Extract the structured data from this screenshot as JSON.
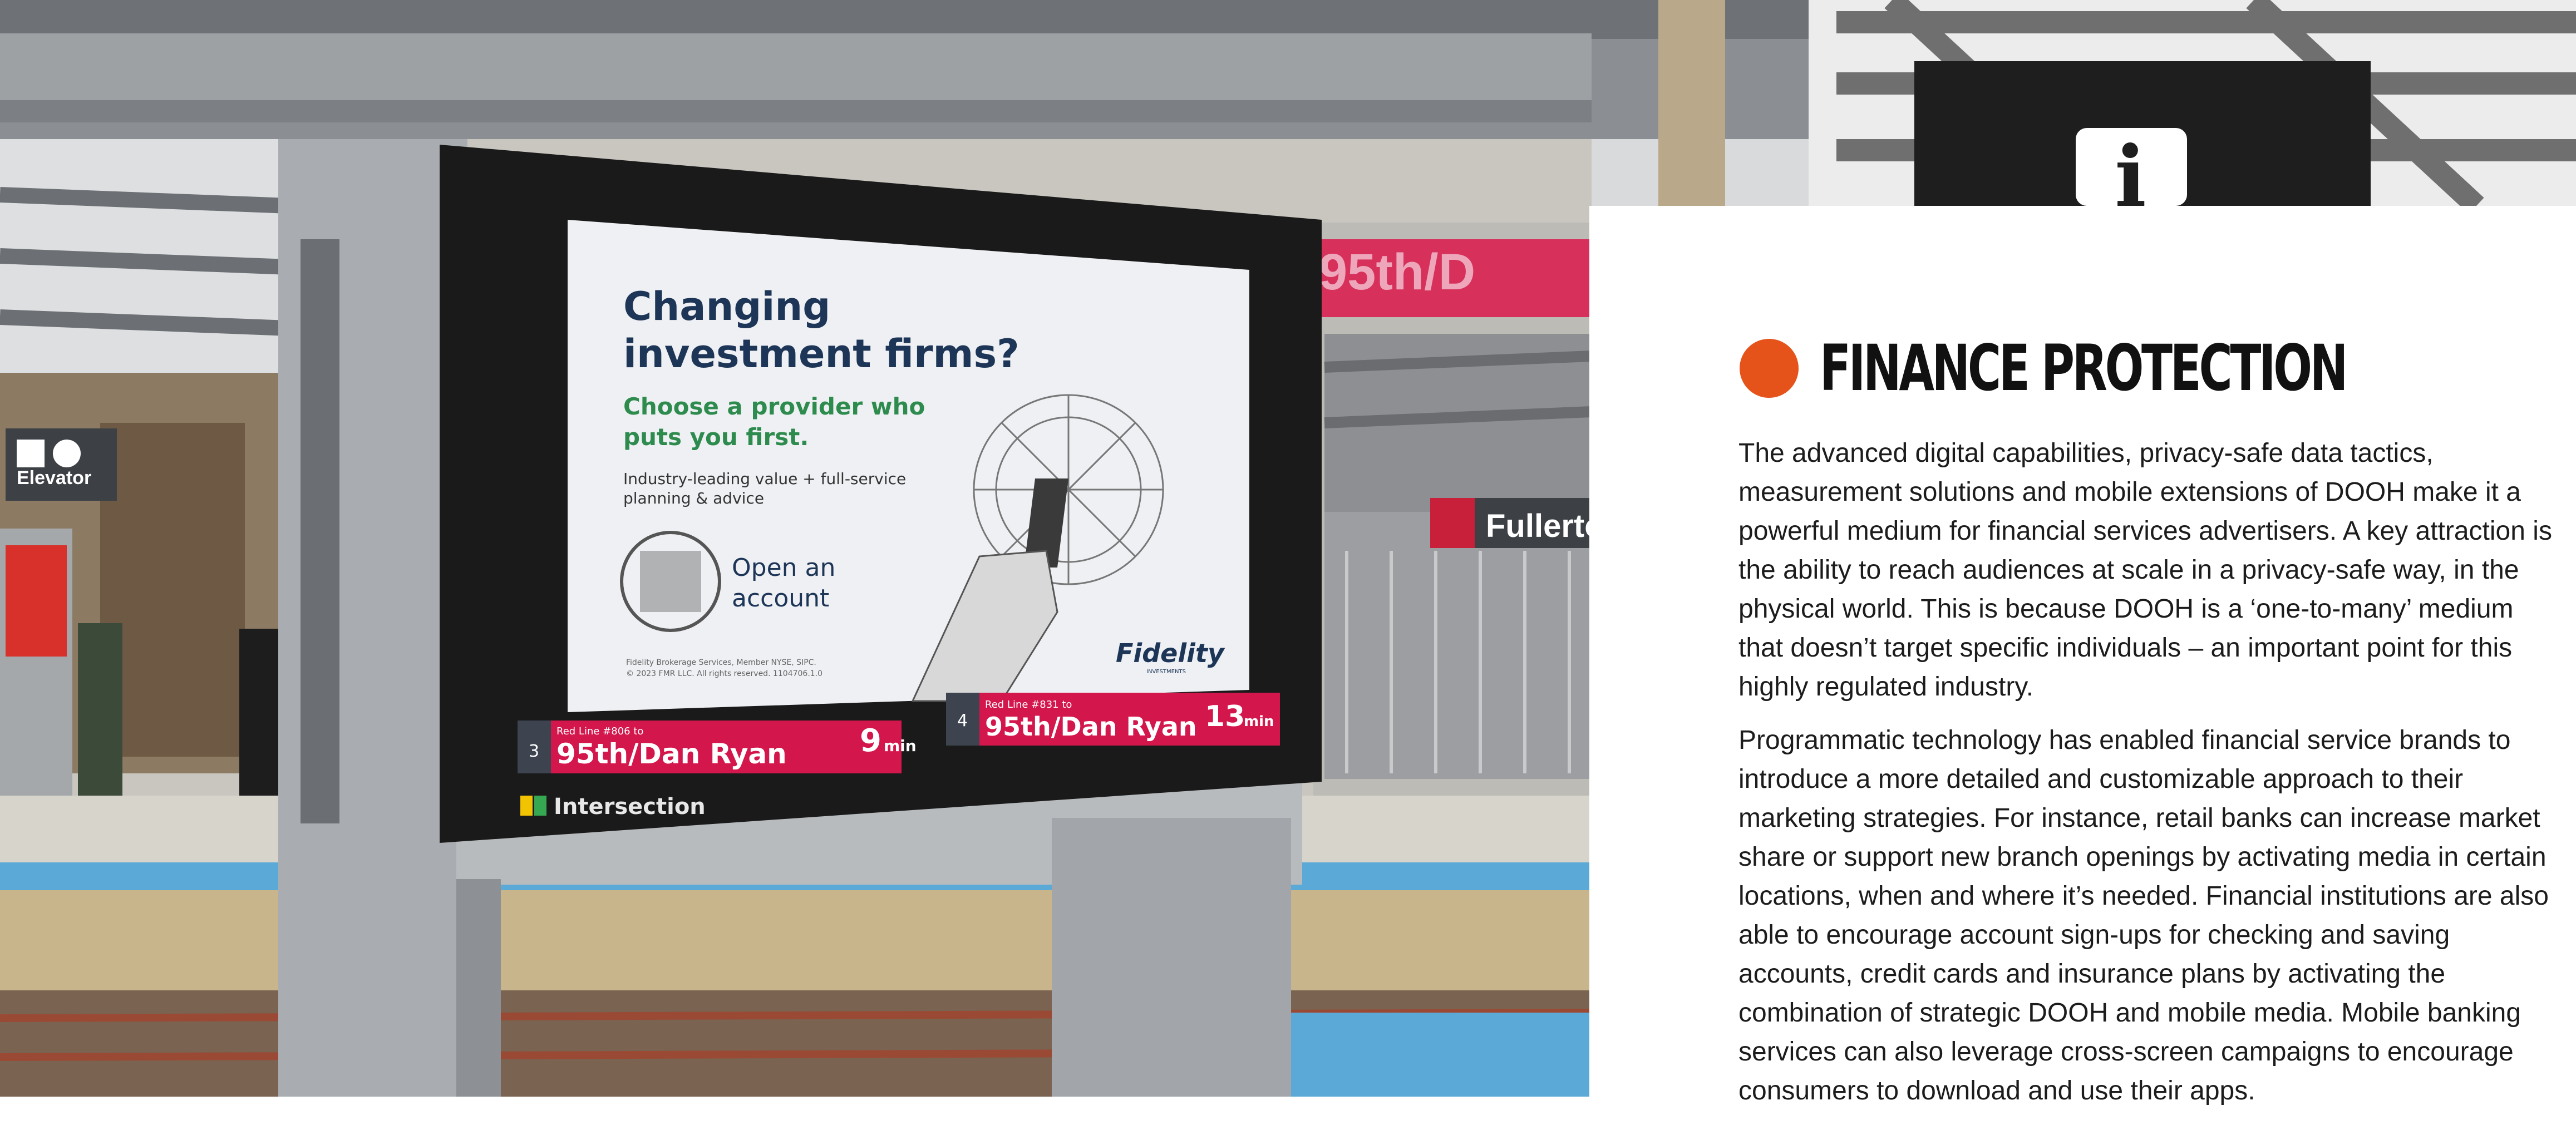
{
  "panel": {
    "title": "FINANCE PROTECTION",
    "accent_color": "#e5531a",
    "paragraphs": [
      "The advanced digital capabilities, privacy-safe data tactics, measurement solutions and mobile extensions of DOOH make it a powerful medium for financial services advertisers. A key attraction is the ability to reach audiences at scale in a privacy-safe way, in the physical world. This is because DOOH is a ‘one-to-many’ medium that doesn’t target specific individuals – an important point for this highly regulated industry.",
      "Programmatic technology has enabled financial service brands to introduce a more detailed and customizable approach to their marketing strategies. For instance, retail banks can increase market share or support new branch openings by activating media in certain locations, when and where it’s needed. Financial institutions are also able to encourage account sign-ups for checking and saving accounts, credit cards and insurance plans by activating the combination of strategic DOOH and mobile media. Mobile banking services can also leverage cross-screen campaigns to encourage consumers to download and use their apps."
    ]
  },
  "ad": {
    "headline_1": "Changing",
    "headline_2": "investment firms?",
    "subhead_1": "Choose a provider who",
    "subhead_2": "puts you first.",
    "body_1": "Industry-leading value + full-service",
    "body_2": "planning & advice",
    "cta_1": "Open an",
    "cta_2": "account",
    "brand": "Fidelity",
    "brand_sub": "INVESTMENTS",
    "legal_1": "Fidelity Brokerage Services, Member NYSE, SIPC.",
    "legal_2": "© 2023 FMR LLC. All rights reserved. 1104706.1.0"
  },
  "arrivals": [
    {
      "slot": "3",
      "line": "Red Line #806 to",
      "destination": "95th/Dan Ryan",
      "minutes": "9",
      "unit": "min"
    },
    {
      "slot": "4",
      "line": "Red Line #831 to",
      "destination": "95th/Dan Ryan",
      "minutes": "13",
      "unit": "min"
    }
  ],
  "signs": {
    "intersection": "Intersection",
    "elevator": "Elevator",
    "station": "Fullerton",
    "platform_banner": "95th/D",
    "info_glyph": "i"
  }
}
